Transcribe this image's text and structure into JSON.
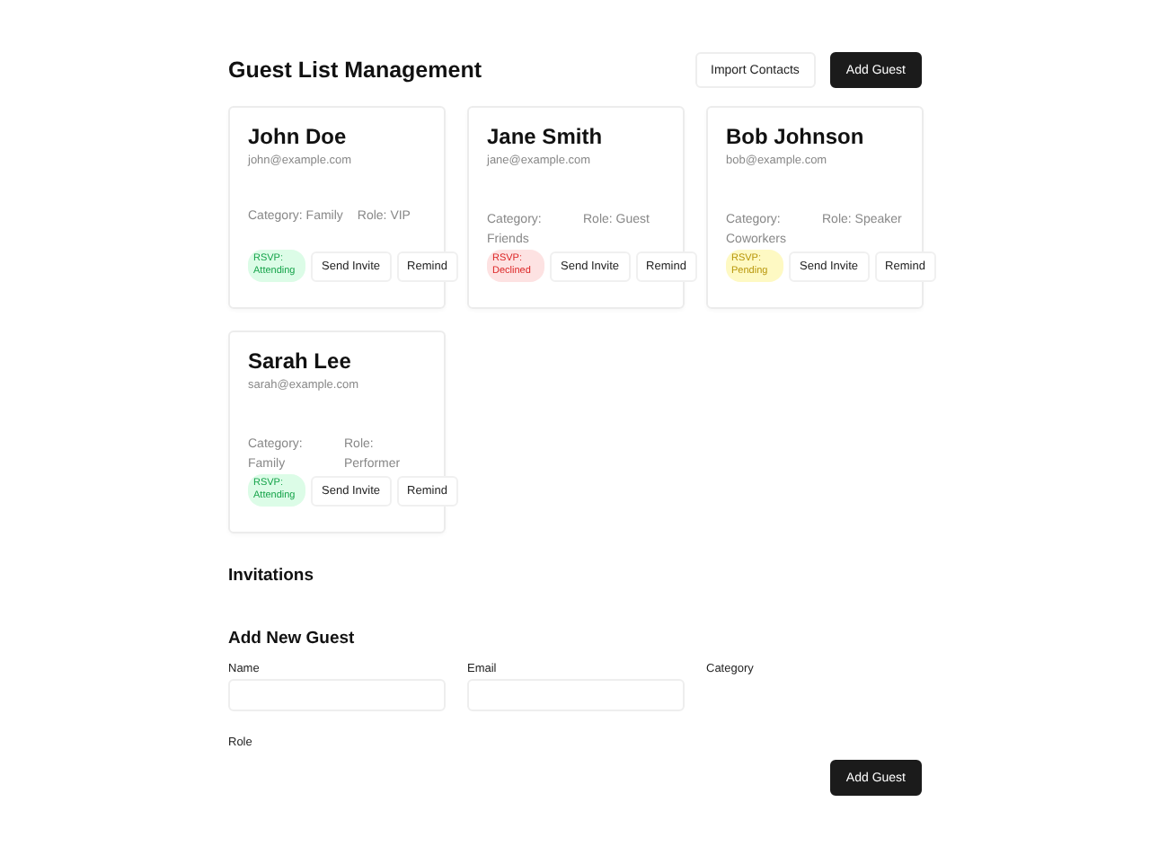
{
  "header": {
    "title": "Guest List Management",
    "buttons": [
      {
        "label": "Import Contacts",
        "kind": "secondary"
      },
      {
        "label": "Add Guest",
        "kind": "primary"
      }
    ]
  },
  "guests": [
    {
      "name": "John Doe",
      "email": "john@example.com",
      "category": "Category: Family",
      "role": "Role: VIP",
      "rsvp": "RSVP: Attending",
      "kind": "attending",
      "actions": [
        "Send Invite",
        "Remind"
      ]
    },
    {
      "name": "Jane Smith",
      "email": "jane@example.com",
      "category": "Category: Friends",
      "role": "Role: Guest",
      "rsvp": "RSVP: Declined",
      "kind": "declined",
      "actions": [
        "Send Invite",
        "Remind"
      ]
    },
    {
      "name": "Bob Johnson",
      "email": "bob@example.com",
      "category": "Category: Coworkers",
      "role": "Role: Speaker",
      "rsvp": "RSVP: Pending",
      "kind": "pending",
      "actions": [
        "Send Invite",
        "Remind"
      ]
    },
    {
      "name": "Sarah Lee",
      "email": "sarah@example.com",
      "category": "Category: Family",
      "role": "Role: Performer",
      "rsvp": "RSVP: Attending",
      "kind": "attending",
      "actions": [
        "Send Invite",
        "Remind"
      ]
    }
  ],
  "invitations": {
    "title": "Invitations"
  },
  "form": {
    "title": "Add New Guest",
    "fields": [
      {
        "label": "Name",
        "kind": "input"
      },
      {
        "label": "Email",
        "kind": "input"
      },
      {
        "label": "Category",
        "kind": "label"
      },
      {
        "label": "Role",
        "kind": "label"
      }
    ],
    "submit": "Add Guest"
  }
}
